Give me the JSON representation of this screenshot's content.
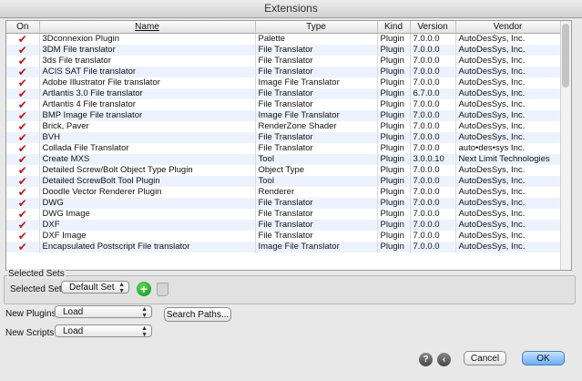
{
  "window": {
    "title": "Extensions"
  },
  "table": {
    "headers": {
      "on": "On",
      "name": "Name",
      "type": "Type",
      "kind": "Kind",
      "version": "Version",
      "vendor": "Vendor"
    },
    "rows": [
      {
        "on": "✔",
        "name": "3Dconnexion Plugin",
        "type": "Palette",
        "kind": "Plugin",
        "version": "7.0.0.0",
        "vendor": "AutoDesSys, Inc."
      },
      {
        "on": "✔",
        "name": "3DM File translator",
        "type": "File Translator",
        "kind": "Plugin",
        "version": "7.0.0.0",
        "vendor": "AutoDesSys, Inc."
      },
      {
        "on": "✔",
        "name": "3ds File translator",
        "type": "File Translator",
        "kind": "Plugin",
        "version": "7.0.0.0",
        "vendor": "AutoDesSys, Inc."
      },
      {
        "on": "✔",
        "name": "ACIS SAT File translator",
        "type": "File Translator",
        "kind": "Plugin",
        "version": "7.0.0.0",
        "vendor": "AutoDesSys, Inc."
      },
      {
        "on": "✔",
        "name": "Adobe Illustrator File translator",
        "type": "Image File Translator",
        "kind": "Plugin",
        "version": "7.0.0.0",
        "vendor": "AutoDesSys, Inc."
      },
      {
        "on": "✔",
        "name": "Artlantis 3.0 File translator",
        "type": "File Translator",
        "kind": "Plugin",
        "version": "6.7.0.0",
        "vendor": "AutoDesSys, Inc."
      },
      {
        "on": "✔",
        "name": "Artlantis 4 File translator",
        "type": "File Translator",
        "kind": "Plugin",
        "version": "7.0.0.0",
        "vendor": "AutoDesSys, Inc."
      },
      {
        "on": "✔",
        "name": "BMP Image File translator",
        "type": "Image File Translator",
        "kind": "Plugin",
        "version": "7.0.0.0",
        "vendor": "AutoDesSys, Inc."
      },
      {
        "on": "✔",
        "name": "Brick, Paver",
        "type": "RenderZone Shader",
        "kind": "Plugin",
        "version": "7.0.0.0",
        "vendor": "AutoDesSys, Inc."
      },
      {
        "on": "✔",
        "name": "BVH",
        "type": "File Translator",
        "kind": "Plugin",
        "version": "7.0.0.0",
        "vendor": "AutoDesSys, Inc."
      },
      {
        "on": "✔",
        "name": "Collada File Translator",
        "type": "File Translator",
        "kind": "Plugin",
        "version": "7.0.0.0",
        "vendor": "auto•des•sys Inc."
      },
      {
        "on": "✔",
        "name": "Create MXS",
        "type": "Tool",
        "kind": "Plugin",
        "version": "3.0.0.10",
        "vendor": "Next Limit Technologies"
      },
      {
        "on": "✔",
        "name": "Detailed Screw/Bolt Object Type Plugin",
        "type": "Object Type",
        "kind": "Plugin",
        "version": "7.0.0.0",
        "vendor": "AutoDesSys, Inc."
      },
      {
        "on": "✔",
        "name": "Detailed ScrewBolt Tool Plugin",
        "type": "Tool",
        "kind": "Plugin",
        "version": "7.0.0.0",
        "vendor": "AutoDesSys, Inc."
      },
      {
        "on": "✔",
        "name": "Doodle Vector Renderer Plugin",
        "type": "Renderer",
        "kind": "Plugin",
        "version": "7.0.0.0",
        "vendor": "AutoDesSys, Inc."
      },
      {
        "on": "✔",
        "name": "DWG",
        "type": "File Translator",
        "kind": "Plugin",
        "version": "7.0.0.0",
        "vendor": "AutoDesSys, Inc."
      },
      {
        "on": "✔",
        "name": "DWG Image",
        "type": "File Translator",
        "kind": "Plugin",
        "version": "7.0.0.0",
        "vendor": "AutoDesSys, Inc."
      },
      {
        "on": "✔",
        "name": "DXF",
        "type": "File Translator",
        "kind": "Plugin",
        "version": "7.0.0.0",
        "vendor": "AutoDesSys, Inc."
      },
      {
        "on": "✔",
        "name": "DXF Image",
        "type": "File Translator",
        "kind": "Plugin",
        "version": "7.0.0.0",
        "vendor": "AutoDesSys, Inc."
      },
      {
        "on": "✔",
        "name": "Encapsulated Postscript File translator",
        "type": "Image File Translator",
        "kind": "Plugin",
        "version": "7.0.0.0",
        "vendor": "AutoDesSys, Inc."
      }
    ]
  },
  "selected_sets": {
    "group_label": "Selected Sets",
    "field_label": "Selected Set:",
    "value": "Default Set",
    "add_icon": "plus-circle-icon",
    "delete_icon": "trash-icon"
  },
  "new_plugins": {
    "label": "New Plugins",
    "value": "Load"
  },
  "search_paths_label": "Search Paths...",
  "new_scripts": {
    "label": "New Scripts",
    "value": "Load"
  },
  "footer": {
    "help_glyph": "?",
    "cancel_label": "Cancel",
    "ok_label": "OK"
  },
  "colors": {
    "check": "#c0141b",
    "row_alt": "#edf3fe",
    "ok_button": "#6aaef4"
  }
}
